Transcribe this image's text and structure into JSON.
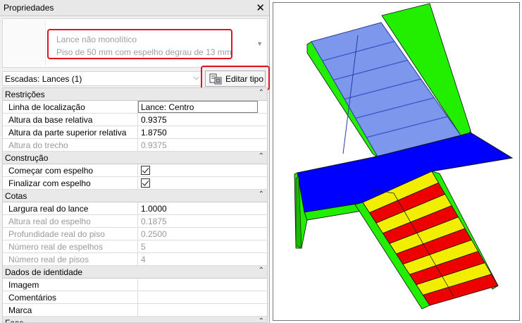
{
  "panel": {
    "title": "Propriedades",
    "close_glyph": "✕",
    "type_selector": {
      "line1": "Lance não monolítico",
      "line2": "Piso de 50 mm com espelho degrau de 13 mm",
      "arrow_glyph": "▼"
    },
    "filter": {
      "label": "Escadas: Lances (1)",
      "chevron_glyph": "⌵"
    },
    "edit_type_button": "Editar tipo"
  },
  "grid": {
    "collapse_glyph": "⌃",
    "rows": [
      {
        "kind": "category",
        "label": "Restrições"
      },
      {
        "kind": "prop",
        "label": "Linha de localização",
        "value": "Lance: Centro",
        "editing": true
      },
      {
        "kind": "prop",
        "label": "Altura da base relativa",
        "value": "0.9375"
      },
      {
        "kind": "prop",
        "label": "Altura da parte superior relativa",
        "value": "1.8750"
      },
      {
        "kind": "prop",
        "label": "Altura do trecho",
        "value": "0.9375",
        "dim": true
      },
      {
        "kind": "category",
        "label": "Construção"
      },
      {
        "kind": "check",
        "label": "Começar com espelho",
        "checked": true
      },
      {
        "kind": "check",
        "label": "Finalizar com espelho",
        "checked": true
      },
      {
        "kind": "category",
        "label": "Cotas"
      },
      {
        "kind": "prop",
        "label": "Largura real do lance",
        "value": "1.0000"
      },
      {
        "kind": "prop",
        "label": "Altura real do espelho",
        "value": "0.1875",
        "dim": true
      },
      {
        "kind": "prop",
        "label": "Profundidade real do piso",
        "value": "0.2500",
        "dim": true
      },
      {
        "kind": "prop",
        "label": "Número real de espelhos",
        "value": "5",
        "dim": true
      },
      {
        "kind": "prop",
        "label": "Número real de pisos",
        "value": "4",
        "dim": true
      },
      {
        "kind": "category",
        "label": "Dados de identidade"
      },
      {
        "kind": "prop",
        "label": "Imagem",
        "value": ""
      },
      {
        "kind": "prop",
        "label": "Comentários",
        "value": ""
      },
      {
        "kind": "prop",
        "label": "Marca",
        "value": ""
      },
      {
        "kind": "category",
        "label": "Fase"
      }
    ]
  },
  "viewport": {
    "colors": {
      "wall": "#22ee00",
      "landing": "#0000ff",
      "selected_run": "#7c97ec",
      "tread": "#f2ee00",
      "riser": "#ee0000"
    }
  },
  "highlight_color": "#e0141e"
}
